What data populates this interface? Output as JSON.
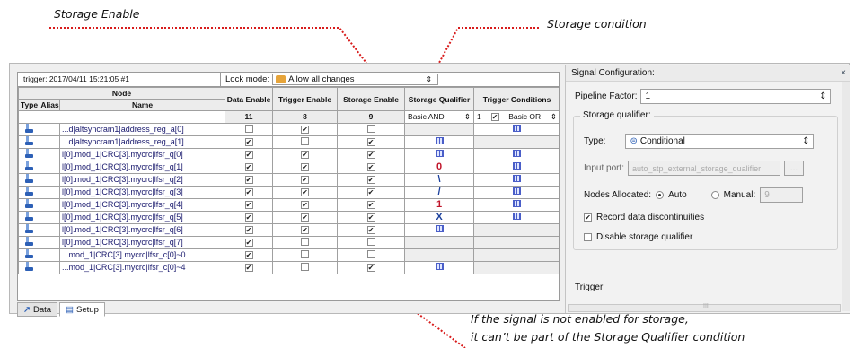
{
  "annotations": {
    "storage_enable": "Storage Enable",
    "storage_condition": "Storage condition",
    "note_line1": "If the signal is not enabled for storage,",
    "note_line2": "it can’t be part of the Storage Qualifier condition"
  },
  "trigger_label": "trigger: 2017/04/11 15:21:05 #1",
  "lock_mode_label": "Lock mode:",
  "lock_mode_value": "Allow all changes",
  "headers": {
    "node": "Node",
    "type": "Type",
    "alias": "Alias",
    "name": "Name",
    "data_enable": "Data Enable",
    "trigger_enable": "Trigger Enable",
    "storage_enable": "Storage Enable",
    "storage_qualifier": "Storage Qualifier",
    "trigger_conditions": "Trigger Conditions"
  },
  "counts": {
    "data_enable": "11",
    "trigger_enable": "8",
    "storage_enable": "9"
  },
  "storage_qualifier_value": "Basic AND",
  "trigger_conditions_value": "Basic OR",
  "trigger_conditions_index": "1",
  "rows": [
    {
      "type": "R",
      "name": "...d|altsyncram1|address_reg_a[0]",
      "data": false,
      "trig": true,
      "stor": false,
      "sq": "",
      "tc": "grid"
    },
    {
      "type": "R",
      "name": "...d|altsyncram1|address_reg_a[1]",
      "data": true,
      "trig": false,
      "stor": true,
      "sq": "grid",
      "tc": ""
    },
    {
      "type": "R",
      "name": "l[0].mod_1|CRC[3].mycrc|lfsr_q[0]",
      "data": true,
      "trig": true,
      "stor": true,
      "sq": "grid",
      "tc": "grid"
    },
    {
      "type": "R",
      "name": "l[0].mod_1|CRC[3].mycrc|lfsr_q[1]",
      "data": true,
      "trig": true,
      "stor": true,
      "sq": "0",
      "tc": "grid"
    },
    {
      "type": "R",
      "name": "l[0].mod_1|CRC[3].mycrc|lfsr_q[2]",
      "data": true,
      "trig": true,
      "stor": true,
      "sq": "\\",
      "tc": "grid"
    },
    {
      "type": "R",
      "name": "l[0].mod_1|CRC[3].mycrc|lfsr_q[3]",
      "data": true,
      "trig": true,
      "stor": true,
      "sq": "/",
      "tc": "grid"
    },
    {
      "type": "R",
      "name": "l[0].mod_1|CRC[3].mycrc|lfsr_q[4]",
      "data": true,
      "trig": true,
      "stor": true,
      "sq": "1",
      "tc": "grid"
    },
    {
      "type": "R",
      "name": "l[0].mod_1|CRC[3].mycrc|lfsr_q[5]",
      "data": true,
      "trig": true,
      "stor": true,
      "sq": "X",
      "tc": "grid"
    },
    {
      "type": "R",
      "name": "l[0].mod_1|CRC[3].mycrc|lfsr_q[6]",
      "data": true,
      "trig": true,
      "stor": true,
      "sq": "grid",
      "tc": ""
    },
    {
      "type": "R",
      "name": "l[0].mod_1|CRC[3].mycrc|lfsr_q[7]",
      "data": true,
      "trig": false,
      "stor": false,
      "sq": "",
      "tc": ""
    },
    {
      "type": "C",
      "name": "...mod_1|CRC[3].mycrc|lfsr_c[0]~0",
      "data": true,
      "trig": false,
      "stor": false,
      "sq": "",
      "tc": ""
    },
    {
      "type": "C",
      "name": "...mod_1|CRC[3].mycrc|lfsr_c[0]~4",
      "data": true,
      "trig": false,
      "stor": true,
      "sq": "grid",
      "tc": ""
    }
  ],
  "tabs": [
    {
      "label": "Data"
    },
    {
      "label": "Setup"
    }
  ],
  "signal_config": {
    "title": "Signal Configuration:",
    "pipeline_label": "Pipeline Factor:",
    "pipeline_value": "1",
    "sq_group": "Storage qualifier:",
    "type_label": "Type:",
    "type_value": "Conditional",
    "input_port_label": "Input port:",
    "input_port_value": "auto_stp_external_storage_qualifier",
    "input_port_btn": "...",
    "nodes_label": "Nodes Allocated:",
    "auto_label": "Auto",
    "manual_label": "Manual:",
    "manual_value": "9",
    "record_label": "Record data discontinuities",
    "record_checked": true,
    "disable_label": "Disable storage qualifier",
    "disable_checked": false,
    "trigger_section": "Trigger",
    "hscroll_label": "III"
  }
}
